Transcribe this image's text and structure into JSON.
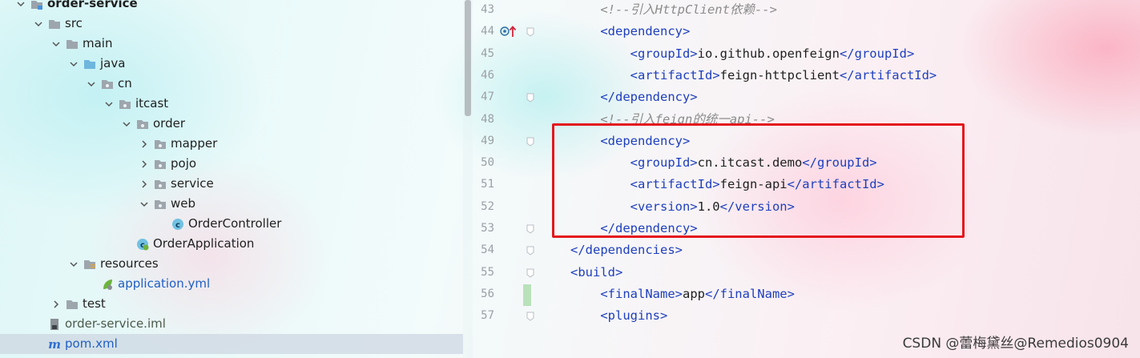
{
  "project_tree": {
    "items": [
      {
        "label": "order-service",
        "kind": "module",
        "expanded": true,
        "bold": true,
        "selected": false
      },
      {
        "label": "src",
        "kind": "folder",
        "expanded": true,
        "selected": false
      },
      {
        "label": "main",
        "kind": "folder",
        "expanded": true,
        "selected": false
      },
      {
        "label": "java",
        "kind": "source-folder",
        "expanded": true,
        "selected": false
      },
      {
        "label": "cn",
        "kind": "package",
        "expanded": true,
        "selected": false
      },
      {
        "label": "itcast",
        "kind": "package",
        "expanded": true,
        "selected": false
      },
      {
        "label": "order",
        "kind": "package",
        "expanded": true,
        "selected": false
      },
      {
        "label": "mapper",
        "kind": "package",
        "expanded": false,
        "selected": false
      },
      {
        "label": "pojo",
        "kind": "package",
        "expanded": false,
        "selected": false
      },
      {
        "label": "service",
        "kind": "package",
        "expanded": false,
        "selected": false
      },
      {
        "label": "web",
        "kind": "package",
        "expanded": true,
        "selected": false
      },
      {
        "label": "OrderController",
        "kind": "class",
        "selected": false
      },
      {
        "label": "OrderApplication",
        "kind": "spring-class",
        "selected": false
      },
      {
        "label": "resources",
        "kind": "resources-folder",
        "expanded": true,
        "selected": false
      },
      {
        "label": "application.yml",
        "kind": "yml",
        "selected": false
      },
      {
        "label": "test",
        "kind": "folder",
        "expanded": false,
        "selected": false
      },
      {
        "label": "order-service.iml",
        "kind": "iml",
        "selected": false
      },
      {
        "label": "pom.xml",
        "kind": "maven",
        "selected": true
      }
    ]
  },
  "editor": {
    "lines": [
      {
        "n": "43",
        "parts": [
          {
            "t": "    <!--引入HttpClient依赖-->",
            "c": "cmt"
          }
        ]
      },
      {
        "n": "44",
        "parts": [
          {
            "t": "    <dependency>",
            "c": "tg"
          }
        ]
      },
      {
        "n": "45",
        "parts": [
          {
            "t": "        <groupId>",
            "c": "tg"
          },
          {
            "t": "io.github.openfeign",
            "c": "tx"
          },
          {
            "t": "</groupId>",
            "c": "tg"
          }
        ]
      },
      {
        "n": "46",
        "parts": [
          {
            "t": "        <artifactId>",
            "c": "tg"
          },
          {
            "t": "feign-httpclient",
            "c": "tx"
          },
          {
            "t": "</artifactId>",
            "c": "tg"
          }
        ]
      },
      {
        "n": "47",
        "parts": [
          {
            "t": "    </dependency>",
            "c": "tg"
          }
        ]
      },
      {
        "n": "48",
        "parts": [
          {
            "t": "    <!--引入feign的统一api-->",
            "c": "cmt"
          }
        ]
      },
      {
        "n": "49",
        "parts": [
          {
            "t": "    <dependency>",
            "c": "tg"
          }
        ]
      },
      {
        "n": "50",
        "parts": [
          {
            "t": "        <groupId>",
            "c": "tg"
          },
          {
            "t": "cn.itcast.demo",
            "c": "tx"
          },
          {
            "t": "</groupId>",
            "c": "tg"
          }
        ]
      },
      {
        "n": "51",
        "parts": [
          {
            "t": "        <artifactId>",
            "c": "tg"
          },
          {
            "t": "feign-api",
            "c": "tx"
          },
          {
            "t": "</artifactId>",
            "c": "tg"
          }
        ]
      },
      {
        "n": "52",
        "parts": [
          {
            "t": "        <version>",
            "c": "tg"
          },
          {
            "t": "1.0",
            "c": "tx"
          },
          {
            "t": "</version>",
            "c": "tg"
          }
        ]
      },
      {
        "n": "53",
        "parts": [
          {
            "t": "    </dependency>",
            "c": "tg"
          }
        ]
      },
      {
        "n": "54",
        "parts": [
          {
            "t": "</dependencies>",
            "c": "tg"
          }
        ]
      },
      {
        "n": "55",
        "parts": [
          {
            "t": "<build>",
            "c": "tg"
          }
        ]
      },
      {
        "n": "56",
        "parts": [
          {
            "t": "    <finalName>",
            "c": "tg"
          },
          {
            "t": "app",
            "c": "tx"
          },
          {
            "t": "</finalName>",
            "c": "tg"
          }
        ]
      },
      {
        "n": "57",
        "parts": [
          {
            "t": "    <plugins>",
            "c": "tg"
          }
        ]
      }
    ]
  },
  "colors": {
    "xml_tag": "#1e3fbe",
    "comment": "#8c8c8c",
    "highlight_box": "#e4161c",
    "selection": "#cdd7e1"
  },
  "watermark": "CSDN @蕾梅黛丝@Remedios0904"
}
